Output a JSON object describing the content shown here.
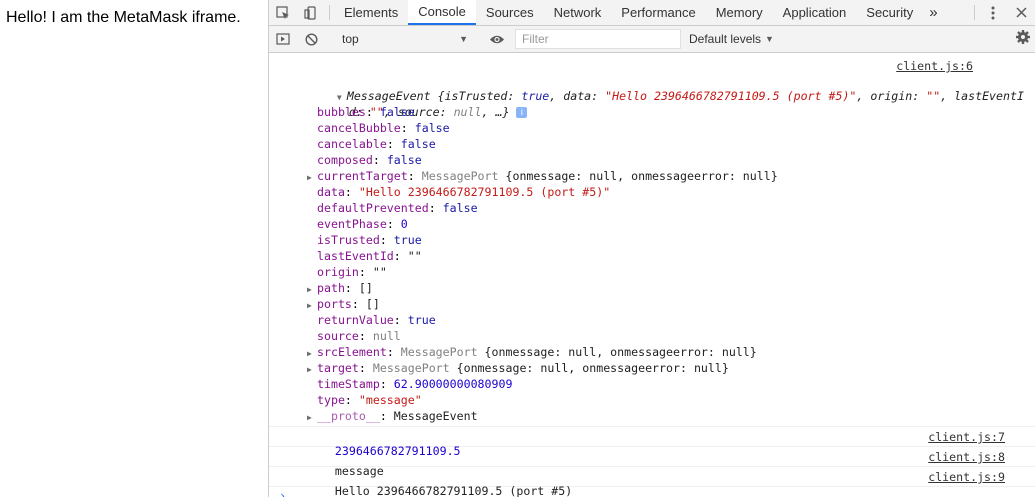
{
  "page": {
    "text": "Hello! I am the MetaMask iframe."
  },
  "devtools": {
    "tabs": [
      "Elements",
      "Console",
      "Sources",
      "Network",
      "Performance",
      "Memory",
      "Application",
      "Security"
    ],
    "active_tab": "Console",
    "more_tabs": "»",
    "toolbar": {
      "context": "top",
      "filter_placeholder": "Filter",
      "levels": "Default levels"
    }
  },
  "console": {
    "event": {
      "source": "client.js:6",
      "summary_class": "MessageEvent",
      "summary_1": " {isTrusted: ",
      "summary_true": "true",
      "summary_2": ", data: ",
      "summary_data": "\"Hello 2396466782791109.5 (port #5)\"",
      "summary_3": ", origin: ",
      "summary_origin": "\"\"",
      "summary_4": ", lastEventI",
      "summary_5": "d: ",
      "summary_lastid": "\"\"",
      "summary_6": ", source: ",
      "summary_null": "null",
      "summary_7": ", …}",
      "props": {
        "bubbles": "false",
        "cancelBubble": "false",
        "cancelable": "false",
        "composed": "false",
        "currentTarget_class": "MessagePort",
        "currentTarget_rest": " {onmessage: null, onmessageerror: null}",
        "data": "\"Hello 2396466782791109.5 (port #5)\"",
        "defaultPrevented": "false",
        "eventPhase": "0",
        "isTrusted": "true",
        "lastEventId": "\"\"",
        "origin": "\"\"",
        "path": "[]",
        "ports": "[]",
        "returnValue": "true",
        "source": "null",
        "srcElement_class": "MessagePort",
        "srcElement_rest": " {onmessage: null, onmessageerror: null}",
        "target_class": "MessagePort",
        "target_rest": " {onmessage: null, onmessageerror: null}",
        "timeStamp": "62.90000000080909",
        "type": "\"message\"",
        "proto": "MessageEvent"
      }
    },
    "logs": [
      {
        "text": "2396466782791109.5",
        "source": "client.js:7"
      },
      {
        "text": "message",
        "source": "client.js:8"
      },
      {
        "text": "Hello 2396466782791109.5 (port #5)",
        "source": "client.js:9"
      }
    ],
    "prompt": "›"
  }
}
